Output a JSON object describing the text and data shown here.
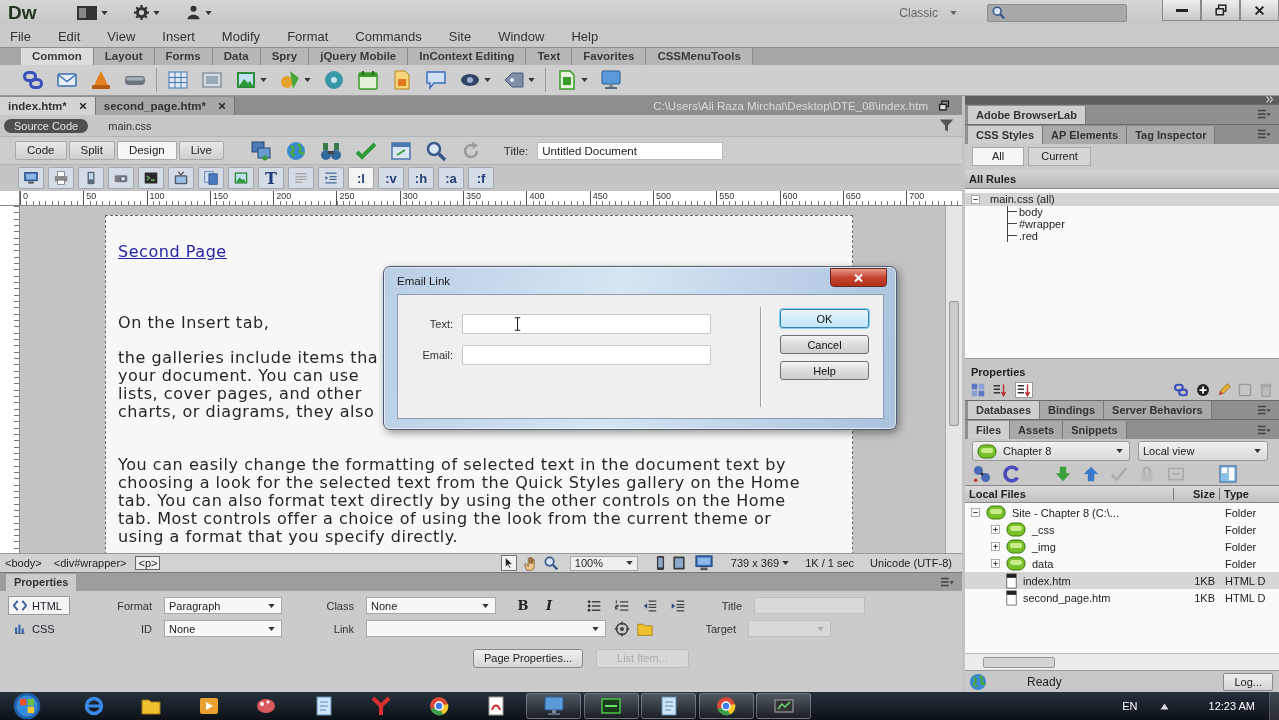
{
  "app_bar": {
    "logo": "Dw",
    "workspace": "Classic"
  },
  "menu": [
    "File",
    "Edit",
    "View",
    "Insert",
    "Modify",
    "Format",
    "Commands",
    "Site",
    "Window",
    "Help"
  ],
  "insert_panel": {
    "tabs": [
      {
        "label": "Common",
        "selected": true
      },
      {
        "label": "Layout",
        "selected": false
      },
      {
        "label": "Forms",
        "selected": false
      },
      {
        "label": "Data",
        "selected": false
      },
      {
        "label": "Spry",
        "selected": false
      },
      {
        "label": "jQuery Mobile",
        "selected": false
      },
      {
        "label": "InContext Editing",
        "selected": false
      },
      {
        "label": "Text",
        "selected": false
      },
      {
        "label": "Favorites",
        "selected": false
      },
      {
        "label": "CSSMenuTools",
        "selected": false
      }
    ]
  },
  "document_tabs": [
    {
      "label": "index.htm*",
      "selected": true
    },
    {
      "label": "second_page.htm*",
      "selected": false
    }
  ],
  "file_path": "C:\\Users\\Ali Raza Mirchal\\Desktop\\DTE_08\\index.htm",
  "related_files": [
    {
      "label": "Source Code",
      "selected": true
    },
    {
      "label": "main.css",
      "selected": false
    }
  ],
  "document_toolbar": {
    "views": [
      {
        "label": "Code",
        "selected": false
      },
      {
        "label": "Split",
        "selected": false
      },
      {
        "label": "Design",
        "selected": true
      },
      {
        "label": "Live",
        "selected": false
      }
    ],
    "title_label": "Title:",
    "title_value": "Untitled Document"
  },
  "style_toolbar": {
    "text_toggle": "T",
    "pseudo_classes": [
      {
        "label": ":l",
        "selected": true
      },
      {
        "label": ":v",
        "selected": false
      },
      {
        "label": ":h",
        "selected": false
      },
      {
        "label": ":a",
        "selected": false
      },
      {
        "label": ":f",
        "selected": false
      }
    ]
  },
  "ruler": [
    "0",
    "50",
    "100",
    "150",
    "200",
    "250",
    "300",
    "350",
    "400",
    "450",
    "500",
    "550",
    "600",
    "650",
    "700"
  ],
  "page": {
    "link": "Second Page",
    "intro": "On the Insert tab,",
    "covered_lines": [
      "the galleries include items tha",
      "your document. You can use",
      "lists, cover pages, and other",
      "charts, or diagrams, they also"
    ],
    "paragraph": "You can easily change the formatting of selected text in the document text by choosing a look for the selected text from the Quick Styles gallery on the Home tab. You can also format text directly by using the other controls on the Home tab. Most controls offer a choice of using the look from the current theme or using a format that you specify directly."
  },
  "dialog": {
    "title": "Email Link",
    "fields": [
      {
        "label": "Text:"
      },
      {
        "label": "Email:"
      }
    ],
    "buttons": [
      {
        "label": "OK",
        "default": true
      },
      {
        "label": "Cancel",
        "default": false
      },
      {
        "label": "Help",
        "default": false
      }
    ]
  },
  "tag_selector": [
    {
      "label": "<body>",
      "selected": false
    },
    {
      "label": "<div#wrapper>",
      "selected": false
    },
    {
      "label": "<p>",
      "selected": true
    }
  ],
  "status": {
    "zoom": "100%",
    "window_size": "739 x 369",
    "download": "1K / 1 sec",
    "encoding": "Unicode (UTF-8)"
  },
  "properties": {
    "title": "Properties",
    "modes": [
      {
        "label": "HTML",
        "selected": true
      },
      {
        "label": "CSS",
        "selected": false
      }
    ],
    "format": {
      "label": "Format",
      "value": "Paragraph"
    },
    "id": {
      "label": "ID",
      "value": "None"
    },
    "class": {
      "label": "Class",
      "value": "None"
    },
    "link": {
      "label": "Link"
    },
    "style_buttons": [
      "B",
      "I"
    ],
    "title_field": {
      "label": "Title",
      "disabled": true
    },
    "target": {
      "label": "Target",
      "disabled": true
    },
    "buttons": [
      {
        "label": "Page Properties...",
        "disabled": false
      },
      {
        "label": "List Item...",
        "disabled": true
      }
    ]
  },
  "right_panel": {
    "browserlab_tab": "Adobe BrowserLab",
    "css_tabs": [
      {
        "label": "CSS Styles",
        "selected": true
      },
      {
        "label": "AP Elements",
        "selected": false
      },
      {
        "label": "Tag Inspector",
        "selected": false
      }
    ],
    "css_modes": [
      {
        "label": "All",
        "selected": true
      },
      {
        "label": "Current",
        "selected": false
      }
    ],
    "rules_heading": "All Rules",
    "rules": [
      {
        "label": "main.css (all)",
        "expanded": true,
        "selected": true,
        "children": [
          {
            "label": "body",
            "selected": false
          },
          {
            "label": "#wrapper",
            "selected": false
          },
          {
            "label": ".red",
            "selected": false
          }
        ]
      }
    ],
    "properties_heading": "Properties",
    "data_tabs": [
      {
        "label": "Databases",
        "selected": true
      },
      {
        "label": "Bindings",
        "selected": false
      },
      {
        "label": "Server Behaviors",
        "selected": false
      }
    ],
    "files_tabs": [
      {
        "label": "Files",
        "selected": true
      },
      {
        "label": "Assets",
        "selected": false
      },
      {
        "label": "Snippets",
        "selected": false
      }
    ],
    "site": "Chapter 8",
    "view": "Local view",
    "columns": [
      "Local Files",
      "Size",
      "Type"
    ],
    "files": [
      {
        "name": "Site - Chapter 8 (C:\\...",
        "type": "Folder",
        "kind": "site",
        "expanded": true,
        "selected": false,
        "children": [
          {
            "name": "_css",
            "type": "Folder",
            "kind": "folder",
            "expanded": false,
            "selected": false
          },
          {
            "name": "_img",
            "type": "Folder",
            "kind": "folder",
            "expanded": false,
            "selected": false
          },
          {
            "name": "data",
            "type": "Folder",
            "kind": "folder",
            "expanded": false,
            "selected": false
          },
          {
            "name": "index.htm",
            "size": "1KB",
            "type": "HTML D",
            "kind": "file",
            "selected": true
          },
          {
            "name": "second_page.htm",
            "size": "1KB",
            "type": "HTML D",
            "kind": "file",
            "selected": false
          }
        ]
      }
    ],
    "status": "Ready",
    "log_button": "Log..."
  },
  "taskbar": {
    "language": "EN",
    "clock": "12:23 AM"
  }
}
